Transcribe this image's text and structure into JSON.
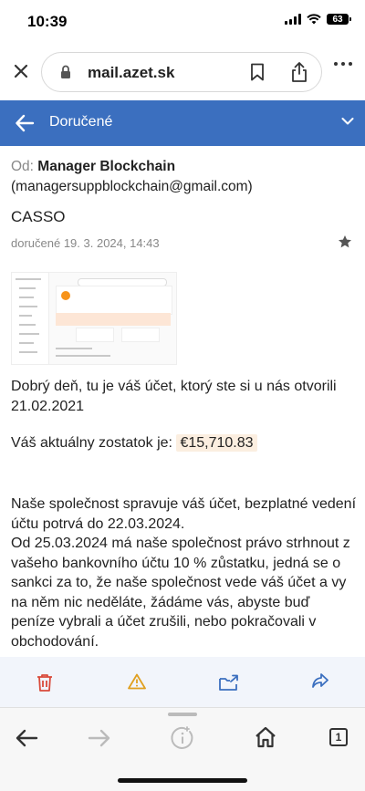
{
  "status": {
    "time": "10:39",
    "battery": "63"
  },
  "browser": {
    "url": "mail.azet.sk"
  },
  "mail_header": {
    "folder": "Doručené"
  },
  "message": {
    "from_label": "Od:",
    "from_name": "Manager Blockchain",
    "from_email": "(managersuppblockchain@gmail.com)",
    "subject": "CASSO",
    "date": "doručené 19. 3. 2024, 14:43",
    "greeting": "Dobrý deň, tu je váš účet, ktorý ste si u nás otvorili 21.02.2021",
    "balance_label": "Váš aktuálny zostatok je:",
    "balance_value": "€15,710.83",
    "paragraph": "Naše společnost spravuje váš účet, bezplatné vedení účtu potrvá do 22.03.2024.\nOd 25.03.2024 má naše společnost právo strhnout z vašeho bankovního účtu 10 % zůstatku, jedná se o sankci za to, že naše společnost vede váš účet a vy na něm nic neděláte, žádáme vás, abyste buď peníze vybrali a účet zrušili, nebo pokračovali v obchodování."
  },
  "colors": {
    "header_bg": "#3b6fbf",
    "delete": "#d94a3a",
    "warning": "#e0a020",
    "accent": "#3b6fbf"
  },
  "actions": [
    "trash-icon",
    "warning-icon",
    "move-icon",
    "forward-icon"
  ],
  "nav": {
    "tabs_count": "1"
  }
}
